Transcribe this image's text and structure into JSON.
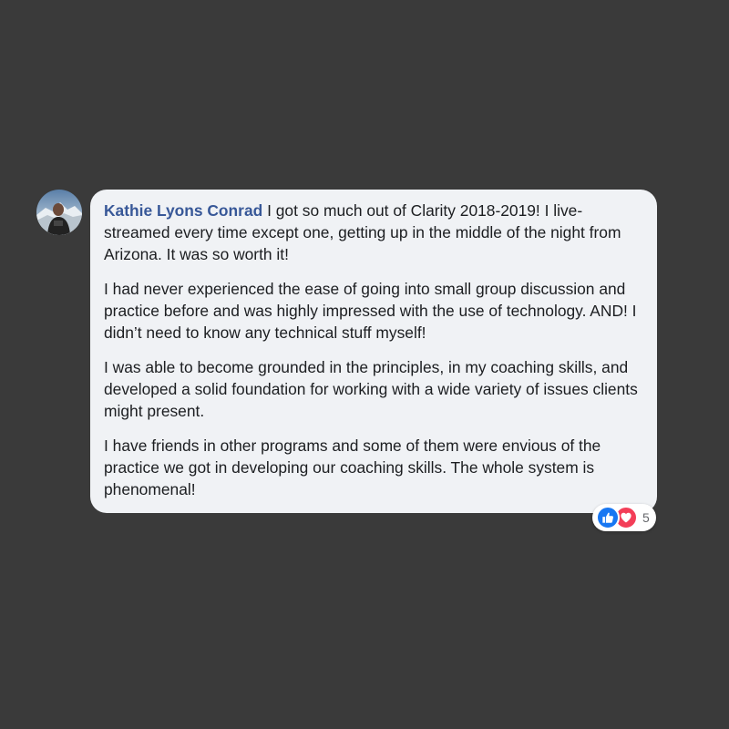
{
  "comment": {
    "author": "Kathie Lyons Conrad",
    "paragraphs": [
      "I got so much out of Clarity 2018-2019! I live-streamed every time except one, getting up in the middle of the night from Arizona. It was so worth it!",
      "I had never experienced the ease of going into small group discussion and practice before and was highly impressed with the use of technology. AND! I didn’t need to know any technical stuff myself!",
      "I was able to become grounded in the principles, in my coaching skills, and developed a solid foundation for working with a wide variety of issues clients might present.",
      "I have friends in other programs and some of them were envious of the practice we got in developing our coaching skills. The whole system is phenomenal!"
    ],
    "reactions": {
      "icons": [
        "like-icon",
        "love-icon"
      ],
      "count": "5"
    }
  },
  "colors": {
    "background": "#3a3a3a",
    "bubble": "#f0f2f5",
    "author_link": "#385898",
    "text": "#1c1e21",
    "like": "#1877f2",
    "love": "#f33e58",
    "count": "#65676b"
  }
}
